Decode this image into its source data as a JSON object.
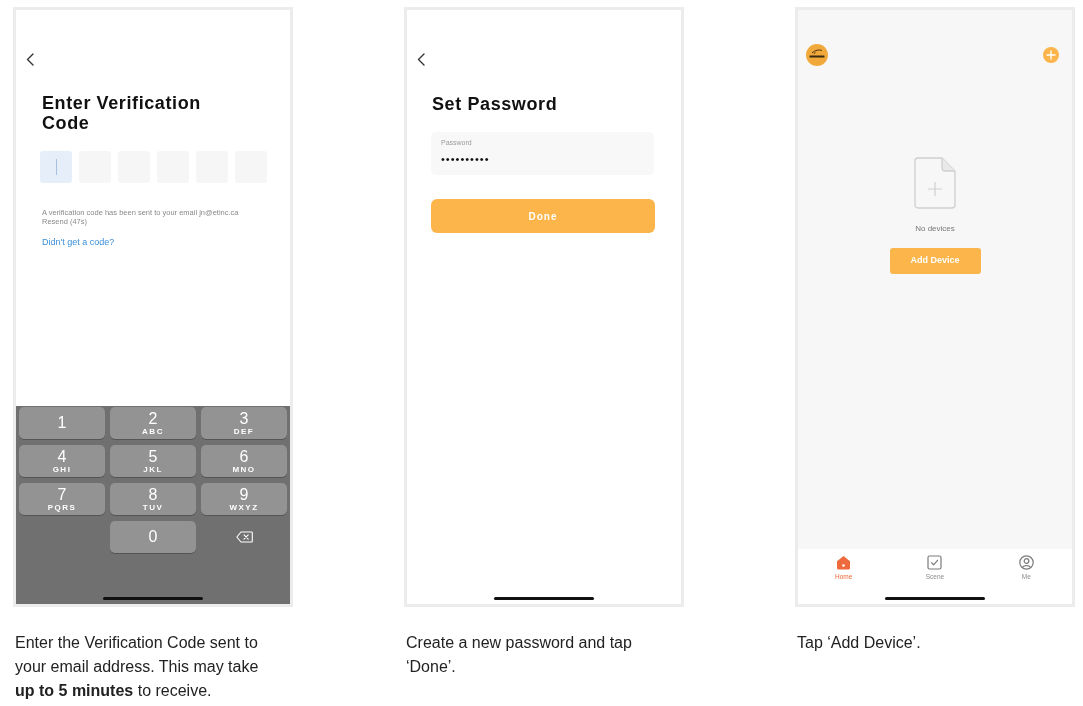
{
  "steps": [
    {
      "screen": {
        "kind": "verification",
        "title": "Enter Verification Code",
        "code_boxes": [
          {
            "focused": true
          },
          {
            "focused": false
          },
          {
            "focused": false
          },
          {
            "focused": false
          },
          {
            "focused": false
          },
          {
            "focused": false
          }
        ],
        "message": "A verification code has been sent to your email jn@etinc.ca",
        "resend": "Resend (47s)",
        "link": "Didn't get a code?",
        "keypad": [
          {
            "kind": "digit",
            "digit": "1"
          },
          {
            "kind": "digit",
            "digit": "2",
            "letters": "ABC"
          },
          {
            "kind": "digit",
            "digit": "3",
            "letters": "DEF"
          },
          {
            "kind": "digit",
            "digit": "4",
            "letters": "GHI"
          },
          {
            "kind": "digit",
            "digit": "5",
            "letters": "JKL"
          },
          {
            "kind": "digit",
            "digit": "6",
            "letters": "MNO"
          },
          {
            "kind": "digit",
            "digit": "7",
            "letters": "PQRS"
          },
          {
            "kind": "digit",
            "digit": "8",
            "letters": "TUV"
          },
          {
            "kind": "digit",
            "digit": "9",
            "letters": "WXYZ"
          },
          {
            "kind": "digit",
            "digit": "0"
          },
          {
            "kind": "delete"
          }
        ]
      },
      "caption": "Enter the Verification Code sent to your email address. This may take **up to 5 minutes** to receive."
    },
    {
      "screen": {
        "kind": "password",
        "title": "Set Password",
        "field": {
          "label": "Password",
          "value": "••••••••••"
        },
        "button": "Done"
      },
      "caption": "Create a new password and tap ‘Done’."
    },
    {
      "screen": {
        "kind": "home",
        "empty_message": "No devices",
        "button": "Add Device",
        "tabs": [
          {
            "kind": "home",
            "label": "Home",
            "selected": true
          },
          {
            "kind": "scene",
            "label": "Scene",
            "selected": false
          },
          {
            "kind": "me",
            "label": "Me",
            "selected": false
          }
        ]
      },
      "caption": "Tap ‘Add Device’."
    }
  ]
}
